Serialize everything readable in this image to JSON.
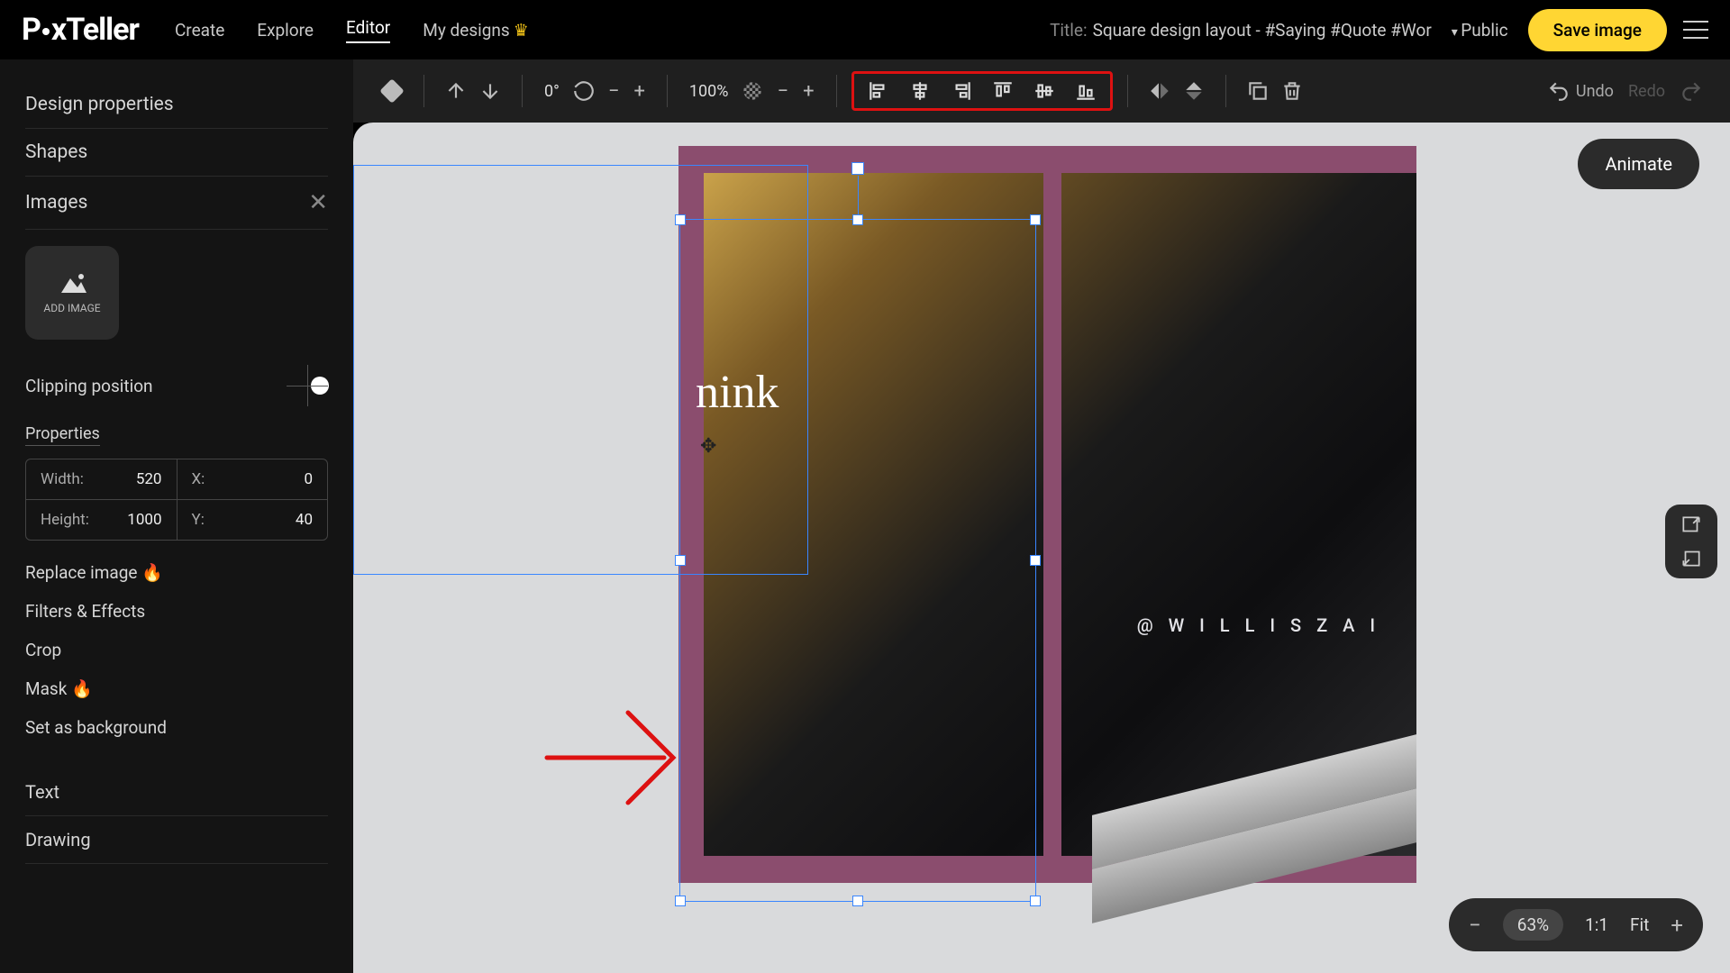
{
  "logo": "PixTeller",
  "nav": {
    "create": "Create",
    "explore": "Explore",
    "editor": "Editor",
    "mydesigns": "My designs"
  },
  "doc": {
    "title_label": "Title:",
    "title": "Square design layout - #Saying #Quote #Wor",
    "visibility": "Public",
    "save": "Save image"
  },
  "toolbar": {
    "rotate": "0°",
    "opacity": "100%",
    "undo": "Undo",
    "redo": "Redo"
  },
  "sidebar": {
    "design_properties": "Design properties",
    "shapes": "Shapes",
    "images": "Images",
    "add_image": "ADD IMAGE",
    "clipping": "Clipping position",
    "properties": "Properties",
    "width_label": "Width:",
    "width": "520",
    "height_label": "Height:",
    "height": "1000",
    "x_label": "X:",
    "x": "0",
    "y_label": "Y:",
    "y": "40",
    "replace": "Replace image",
    "filters": "Filters & Effects",
    "crop": "Crop",
    "mask": "Mask",
    "setbg": "Set as background",
    "text": "Text",
    "drawing": "Drawing"
  },
  "canvas": {
    "overlay_text": "nink",
    "watermark": "@ W I L L I S Z A I"
  },
  "animate": "Animate",
  "zoom": {
    "pct": "63%",
    "ratio": "1:1",
    "fit": "Fit"
  }
}
